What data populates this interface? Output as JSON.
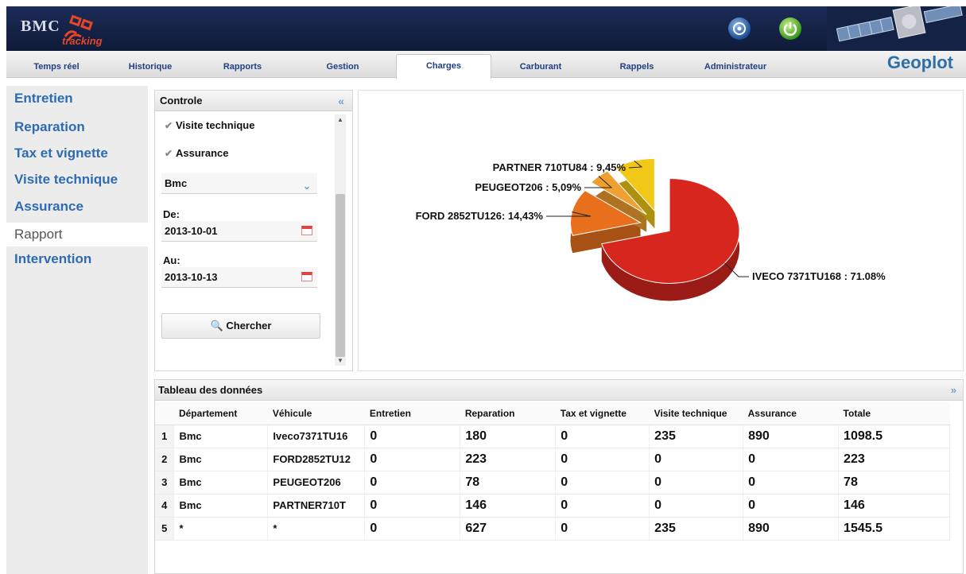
{
  "header": {
    "logo_text": "BMC",
    "logo_subtext": "tracking",
    "brand": "Geoplot"
  },
  "tabs": [
    {
      "label": "Temps réel"
    },
    {
      "label": "Historique"
    },
    {
      "label": "Rapports"
    },
    {
      "label": "Gestion"
    },
    {
      "label": "Charges",
      "active": true
    },
    {
      "label": "Carburant"
    },
    {
      "label": "Rappels"
    },
    {
      "label": "Administrateur"
    }
  ],
  "sidebar": {
    "items": [
      {
        "label": "Entretien"
      },
      {
        "label": "Reparation"
      },
      {
        "label": "Tax et vignette"
      },
      {
        "label": "Visite technique"
      },
      {
        "label": "Assurance"
      },
      {
        "label": "Rapport",
        "active": true
      },
      {
        "label": "Intervention"
      }
    ]
  },
  "controle": {
    "title": "Controle",
    "checkboxes": [
      {
        "label": "Visite technique",
        "checked": true
      },
      {
        "label": "Assurance",
        "checked": true
      }
    ],
    "department_select": "Bmc",
    "from_label": "De:",
    "from_value": "2013-10-01",
    "to_label": "Au:",
    "to_value": "2013-10-13",
    "search_label": "Chercher"
  },
  "chart_data": {
    "type": "pie",
    "title": "",
    "slices": [
      {
        "label": "IVECO 7371TU168 : 71.08%",
        "value": 71.08,
        "color": "#d7261e"
      },
      {
        "label": "FORD 2852TU126: 14,43%",
        "value": 14.43,
        "color": "#e8701c"
      },
      {
        "label": "PEUGEOT206 : 5,09%",
        "value": 5.09,
        "color": "#f0a030"
      },
      {
        "label": "PARTNER 710TU84 : 9,45%",
        "value": 9.45,
        "color": "#f2c818"
      }
    ]
  },
  "table": {
    "title": "Tableau des données",
    "columns": [
      "Département",
      "Véhicule",
      "Entretien",
      "Reparation",
      "Tax et vignette",
      "Visite technique",
      "Assurance",
      "Totale"
    ],
    "rows": [
      {
        "idx": "1",
        "cells": [
          "Bmc",
          "Iveco7371TU16",
          "0",
          "180",
          "0",
          "235",
          "890",
          "1098.5"
        ]
      },
      {
        "idx": "2",
        "cells": [
          "Bmc",
          "FORD2852TU12",
          "0",
          "223",
          "0",
          "0",
          "0",
          "223"
        ]
      },
      {
        "idx": "3",
        "cells": [
          "Bmc",
          "PEUGEOT206",
          "0",
          "78",
          "0",
          "0",
          "0",
          "78"
        ]
      },
      {
        "idx": "4",
        "cells": [
          "Bmc",
          "PARTNER710T",
          "0",
          "146",
          "0",
          "0",
          "0",
          "146"
        ]
      },
      {
        "idx": "5",
        "cells": [
          "*",
          "*",
          "0",
          "627",
          "0",
          "235",
          "890",
          "1545.5"
        ]
      }
    ]
  }
}
